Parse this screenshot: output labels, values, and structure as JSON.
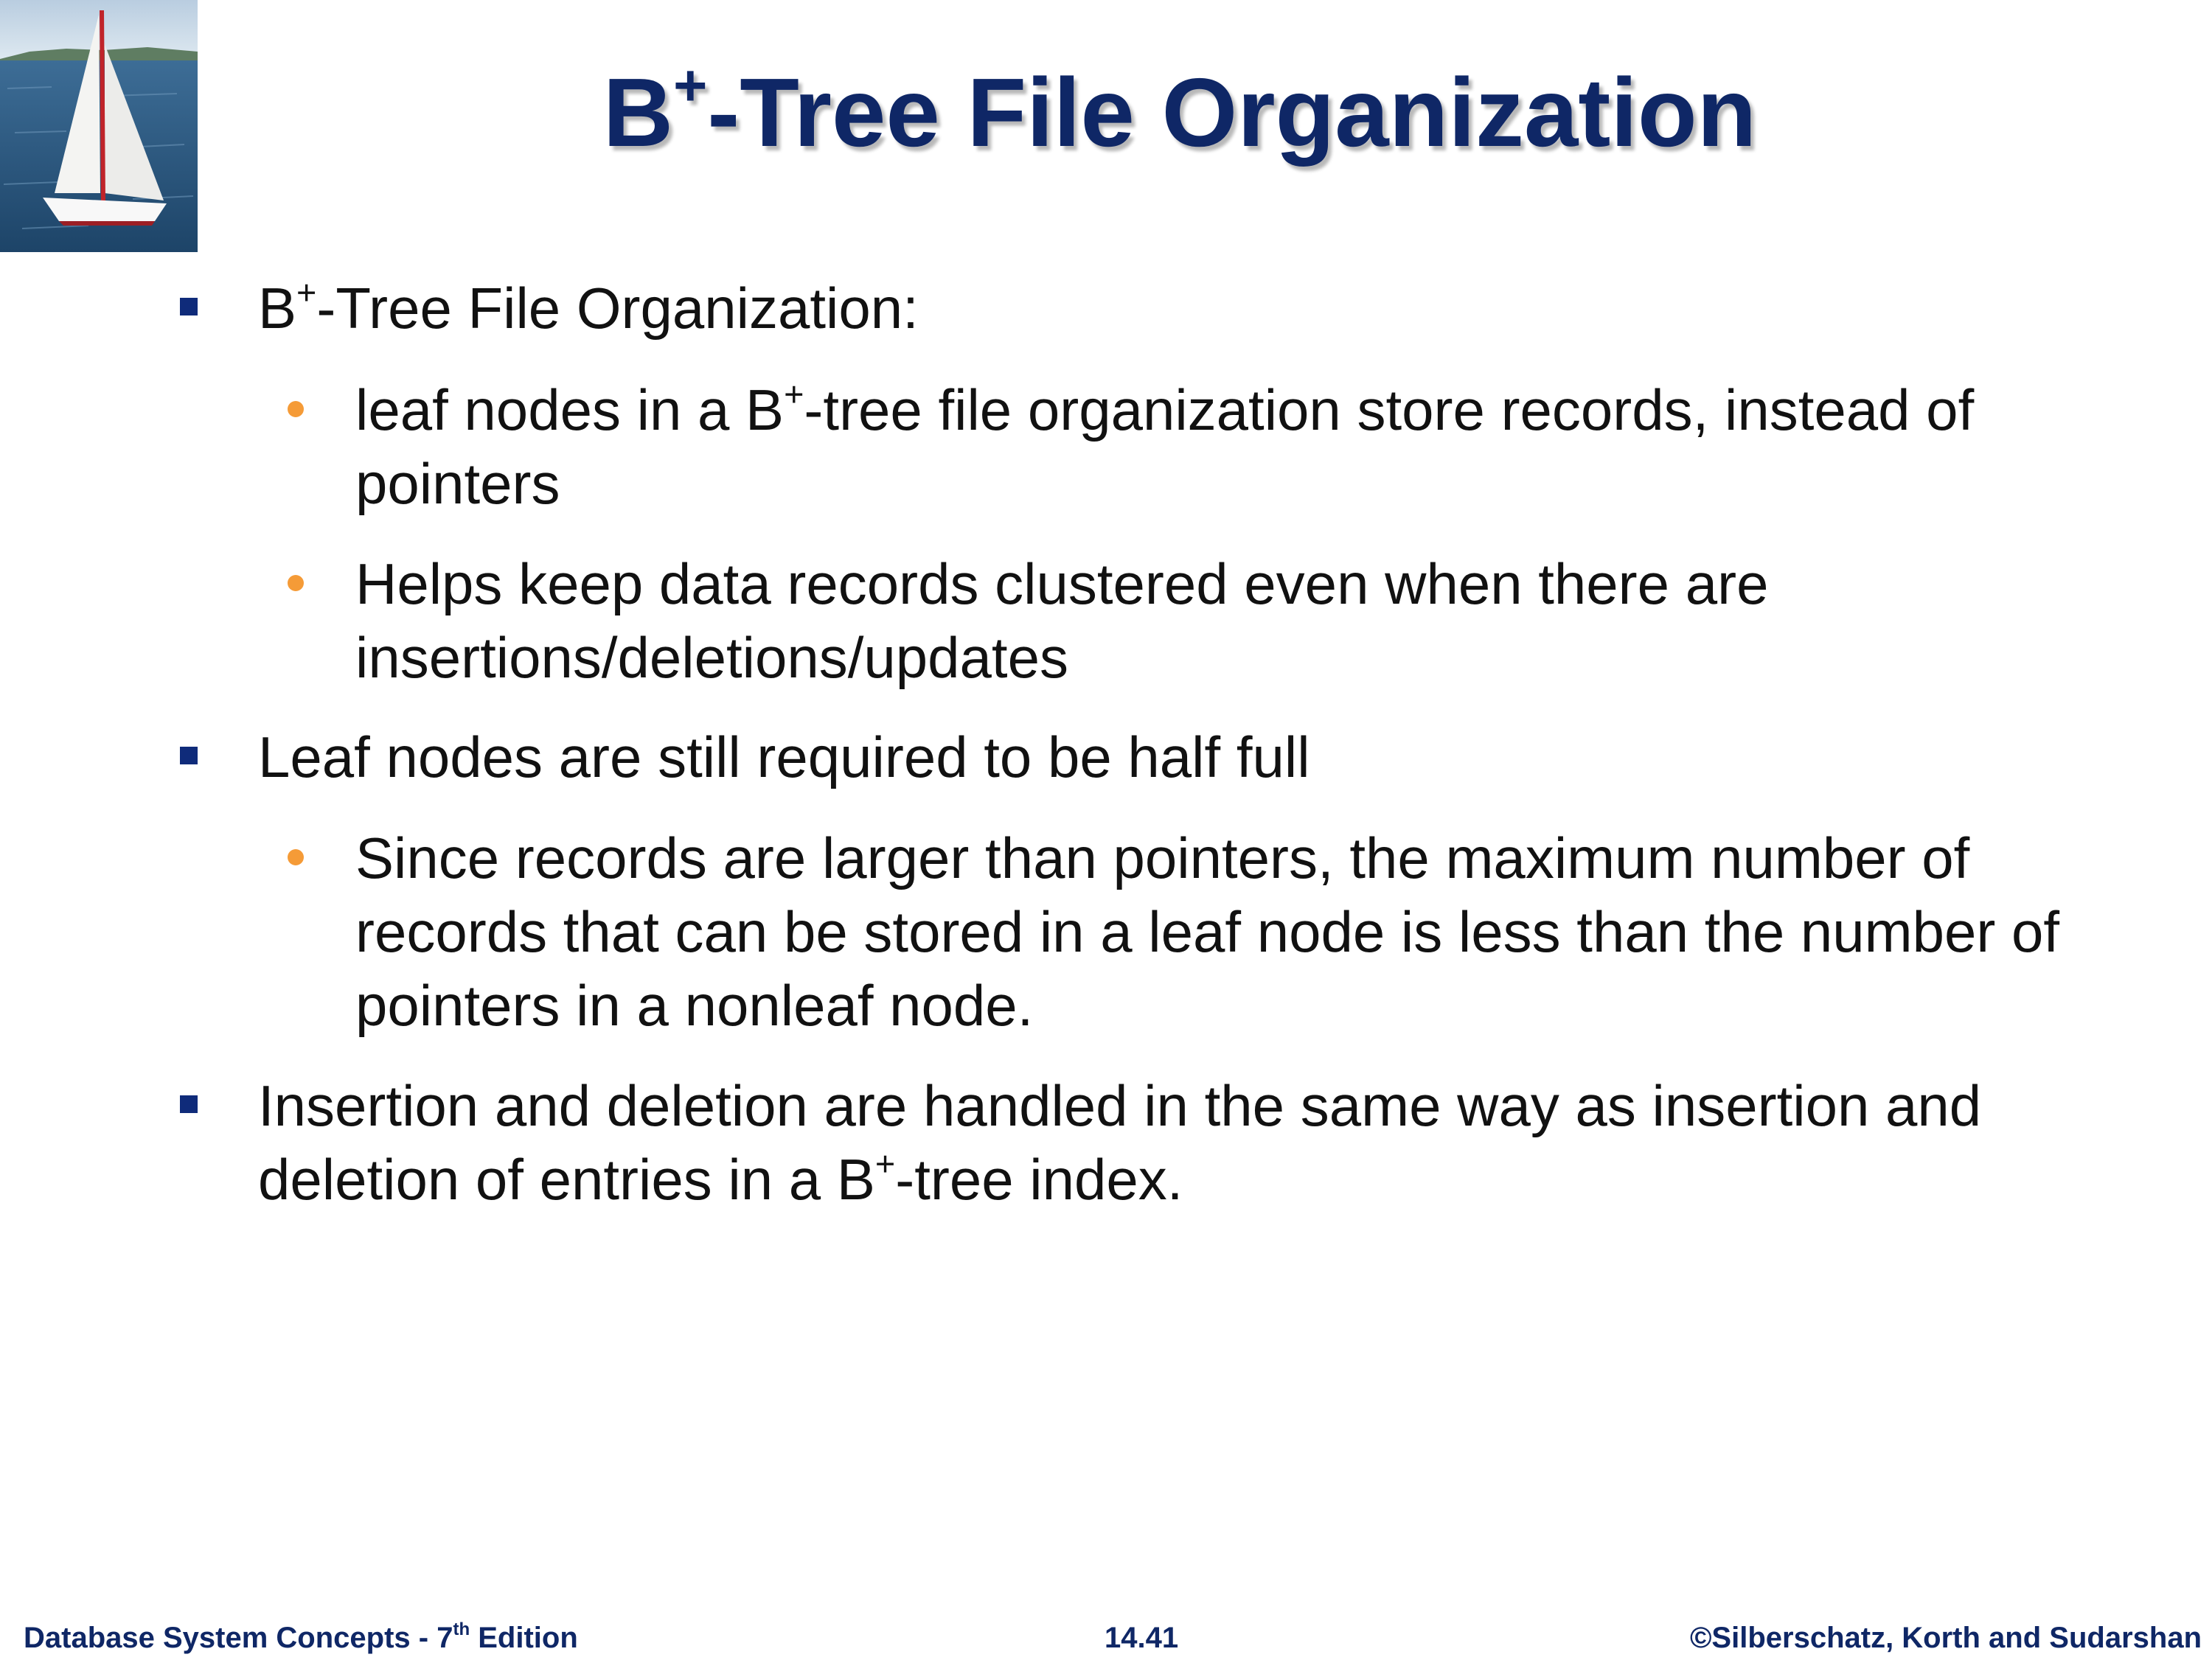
{
  "slide": {
    "title_prefix": "B",
    "title_sup": "+",
    "title_suffix": "-Tree File Organization"
  },
  "bullets": [
    {
      "level": 1,
      "prefix": "B",
      "sup": "+",
      "suffix": "-Tree File Organization:"
    },
    {
      "level": 2,
      "prefix": "leaf nodes in a B",
      "sup": "+",
      "suffix": "-tree file organization store records, instead of pointers"
    },
    {
      "level": 2,
      "text": "Helps keep data records clustered even when there are insertions/deletions/updates"
    },
    {
      "level": 1,
      "text": "Leaf nodes are still required to be half full"
    },
    {
      "level": 2,
      "text": "Since records are larger than pointers, the maximum number of records that can be stored in a leaf node is less than the number of pointers in a nonleaf node."
    },
    {
      "level": 1,
      "prefix": "Insertion and deletion are handled in the same way as insertion and deletion of entries in a B",
      "sup": "+",
      "suffix": "-tree index."
    }
  ],
  "footer": {
    "left_prefix": "Database System Concepts - 7",
    "left_sup": "th",
    "left_suffix": " Edition",
    "center": "14.41",
    "right": "©Silberschatz, Korth and Sudarshan"
  },
  "colors": {
    "title": "#0f2766",
    "level1_marker": "#0f2b7a",
    "level2_marker": "#f59b37",
    "body_text": "#111111"
  },
  "icons": {
    "logo": "sailboat-logo"
  }
}
